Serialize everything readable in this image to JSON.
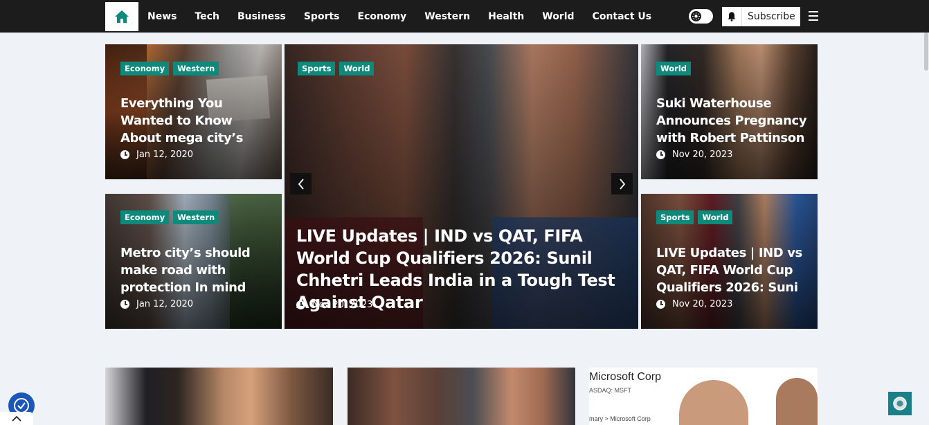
{
  "nav": {
    "items": [
      "News",
      "Tech",
      "Business",
      "Sports",
      "Economy",
      "Western",
      "Health",
      "World",
      "Contact Us"
    ],
    "subscribe_label": "Subscribe"
  },
  "cards": {
    "tl": {
      "tags": [
        "Economy",
        "Western"
      ],
      "title": "Everything You Wanted to Know About mega city’s",
      "date": "Jan 12, 2020"
    },
    "bl": {
      "tags": [
        "Economy",
        "Western"
      ],
      "title": "Metro city’s should make road with protection In mind",
      "date": "Jan 12, 2020"
    },
    "main": {
      "tags": [
        "Sports",
        "World"
      ],
      "title": "LIVE Updates | IND vs QAT, FIFA World Cup Qualifiers 2026: Sunil Chhetri Leads India in a Tough Test Against Qatar",
      "date": "Nov 20, 2023"
    },
    "tr": {
      "tags": [
        "World"
      ],
      "title": "Suki Waterhouse Announces Pregnancy with Robert Pattinson",
      "date": "Nov 20, 2023"
    },
    "br": {
      "tags": [
        "Sports",
        "World"
      ],
      "title": "LIVE Updates | IND vs QAT, FIFA World Cup Qualifiers 2026: Suni",
      "date": "Nov 20, 2023"
    }
  },
  "thumb3": {
    "corp": "Microsoft Corp",
    "ticker": "ASDAQ: MSFT",
    "crumb": "mary > Microsoft Corp"
  },
  "colors": {
    "nav_bg": "#1c1c1c",
    "tag_bg": "#0e8a7c",
    "page_bg": "#eff2f7"
  },
  "icons": [
    "home-icon",
    "sun-icon",
    "bell-icon",
    "menu-icon",
    "clock-icon",
    "chevron-left-icon",
    "chevron-right-icon",
    "chevron-up-icon",
    "accessibility-icon",
    "chat-icon"
  ]
}
